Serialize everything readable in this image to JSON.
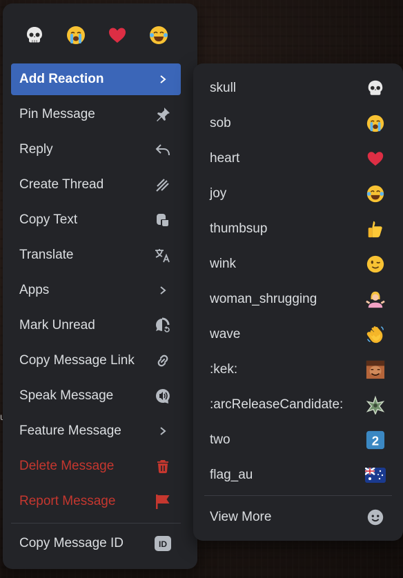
{
  "quick_reactions": [
    {
      "name": "skull-icon"
    },
    {
      "name": "sob-icon"
    },
    {
      "name": "heart-icon"
    },
    {
      "name": "joy-icon"
    }
  ],
  "menu": {
    "items": [
      {
        "label": "Add Reaction",
        "icon": "chevron-right-icon"
      },
      {
        "label": "Pin Message",
        "icon": "pin-icon"
      },
      {
        "label": "Reply",
        "icon": "reply-icon"
      },
      {
        "label": "Create Thread",
        "icon": "thread-icon"
      },
      {
        "label": "Copy Text",
        "icon": "copy-icon"
      },
      {
        "label": "Translate",
        "icon": "translate-icon"
      },
      {
        "label": "Apps",
        "icon": "chevron-right-icon"
      },
      {
        "label": "Mark Unread",
        "icon": "mark-unread-icon"
      },
      {
        "label": "Copy Message Link",
        "icon": "link-icon"
      },
      {
        "label": "Speak Message",
        "icon": "speak-icon"
      },
      {
        "label": "Feature Message",
        "icon": "chevron-right-icon"
      },
      {
        "label": "Delete Message",
        "icon": "trash-icon"
      },
      {
        "label": "Report Message",
        "icon": "flag-icon"
      },
      {
        "label": "Copy Message ID",
        "icon": "id-icon"
      }
    ]
  },
  "submenu": {
    "items": [
      {
        "label": "skull"
      },
      {
        "label": "sob"
      },
      {
        "label": "heart"
      },
      {
        "label": "joy"
      },
      {
        "label": "thumbsup"
      },
      {
        "label": "wink"
      },
      {
        "label": "woman_shrugging"
      },
      {
        "label": "wave"
      },
      {
        "label": ":kek:"
      },
      {
        "label": ":arcReleaseCandidate:"
      },
      {
        "label": "two"
      },
      {
        "label": "flag_au"
      }
    ],
    "view_more": "View More"
  },
  "background": {
    "stray_text": "u"
  },
  "colors": {
    "accent": "#3b66b8",
    "danger": "#c5372f",
    "menu_bg": "#232428",
    "text": "#dbdee1"
  }
}
